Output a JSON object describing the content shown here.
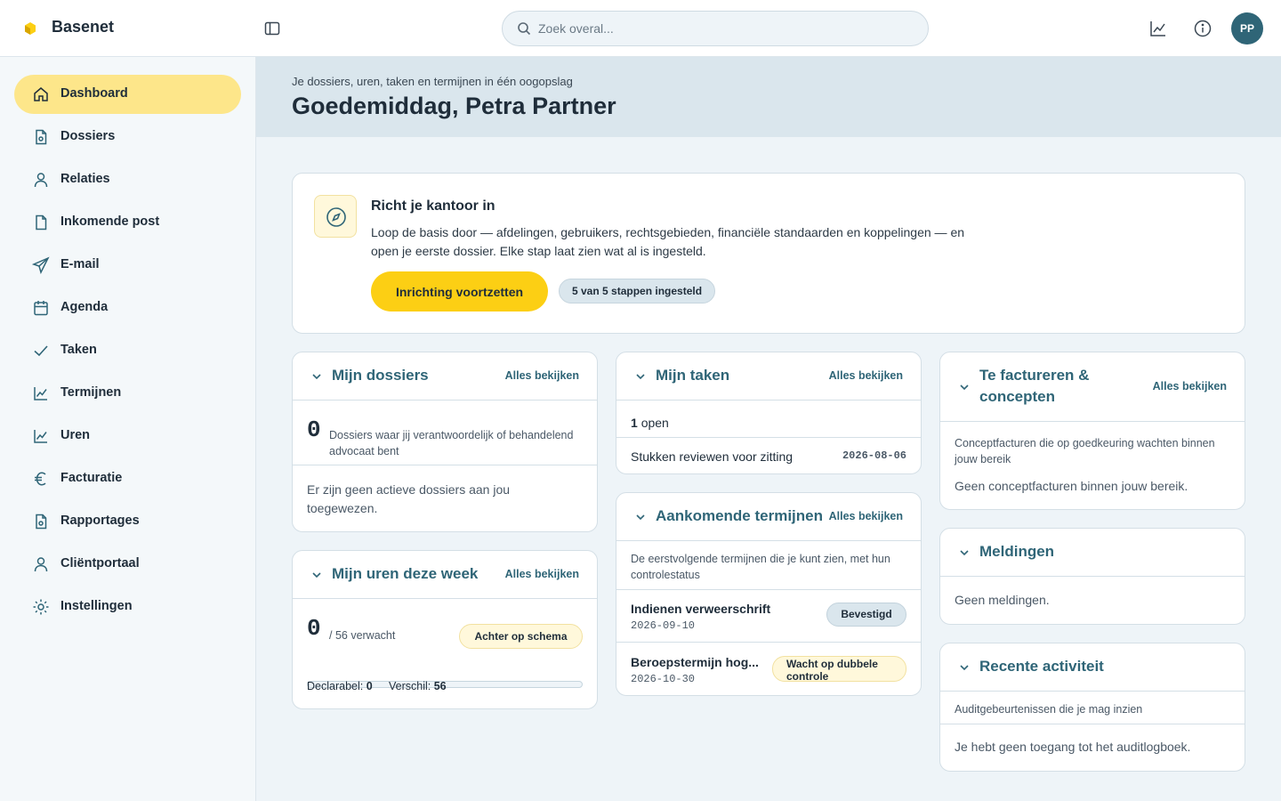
{
  "app": {
    "brand": "Basenet"
  },
  "search": {
    "placeholder": "Zoek overal..."
  },
  "user": {
    "initials": "PP"
  },
  "colors": {
    "accent": "#fccf14",
    "primary": "#2f6577",
    "active_nav": "#fde68a"
  },
  "sidebar": {
    "items": [
      {
        "label": "Dashboard",
        "icon": "home-icon",
        "active": true
      },
      {
        "label": "Dossiers",
        "icon": "file-icon"
      },
      {
        "label": "Relaties",
        "icon": "user-icon"
      },
      {
        "label": "Inkomende post",
        "icon": "document-icon"
      },
      {
        "label": "E-mail",
        "icon": "send-icon"
      },
      {
        "label": "Agenda",
        "icon": "calendar-icon"
      },
      {
        "label": "Taken",
        "icon": "check-icon"
      },
      {
        "label": "Termijnen",
        "icon": "chart-line-icon"
      },
      {
        "label": "Uren",
        "icon": "chart-line-icon"
      },
      {
        "label": "Facturatie",
        "icon": "euro-icon"
      },
      {
        "label": "Rapportages",
        "icon": "report-icon"
      },
      {
        "label": "Cliëntportaal",
        "icon": "user-icon"
      },
      {
        "label": "Instellingen",
        "icon": "gear-icon"
      }
    ]
  },
  "header": {
    "subtitle": "Je dossiers, uren, taken en termijnen in één oogopslag",
    "title": "Goedemiddag, Petra Partner"
  },
  "setup": {
    "title": "Richt je kantoor in",
    "text": "Loop de basis door — afdelingen, gebruikers, rechtsgebieden, financiële standaarden en koppelingen — en open je eerste dossier. Elke stap laat zien wat al is ingesteld.",
    "button": "Inrichting voortzetten",
    "steps": "5 van 5 stappen ingesteld"
  },
  "see_all": "Alles bekijken",
  "dossiers": {
    "title": "Mijn dossiers",
    "count": "0",
    "count_label": "Dossiers waar jij verantwoordelijk of behandelend advocaat bent",
    "empty": "Er zijn geen actieve dossiers aan jou toegewezen."
  },
  "hours": {
    "title": "Mijn uren deze week",
    "value": "0",
    "expected": "/ 56 verwacht",
    "status": "Achter op schema",
    "progress": 0,
    "declarable_label": "Declarabel:",
    "declarable": "0",
    "diff_label": "Verschil:",
    "diff": "56"
  },
  "tasks": {
    "title": "Mijn taken",
    "open_count": "1",
    "open_label": "open",
    "items": [
      {
        "title": "Stukken reviewen voor zitting",
        "date": "2026-08-06"
      }
    ]
  },
  "deadlines": {
    "title": "Aankomende termijnen",
    "description": "De eerstvolgende termijnen die je kunt zien, met hun controlestatus",
    "items": [
      {
        "title": "Indienen verweerschrift",
        "date": "2026-09-10",
        "status": "Bevestigd"
      },
      {
        "title": "Beroepstermijn hog...",
        "date": "2026-10-30",
        "status": "Wacht op dubbele controle"
      }
    ]
  },
  "invoices": {
    "title": "Te factureren & concepten",
    "description": "Conceptfacturen die op goedkeuring wachten binnen jouw bereik",
    "empty": "Geen conceptfacturen binnen jouw bereik."
  },
  "notifications": {
    "title": "Meldingen",
    "empty": "Geen meldingen."
  },
  "activity": {
    "title": "Recente activiteit",
    "description": "Auditgebeurtenissen die je mag inzien",
    "empty": "Je hebt geen toegang tot het auditlogboek."
  }
}
